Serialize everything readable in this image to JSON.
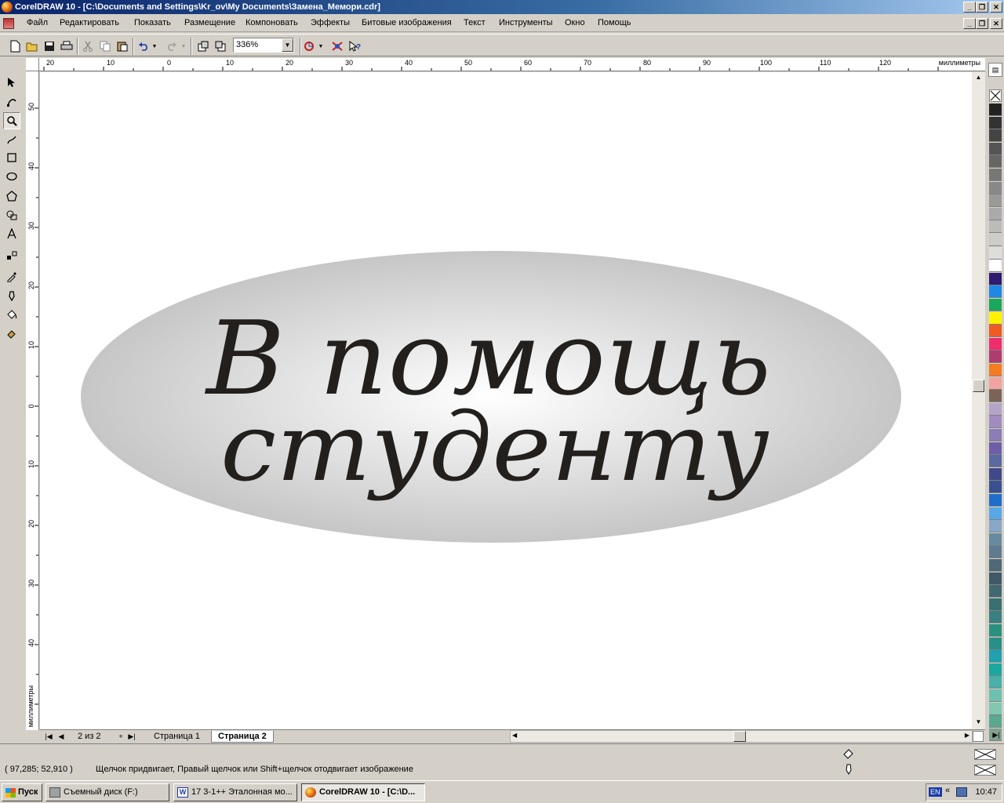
{
  "window": {
    "title": "CorelDRAW 10 - [C:\\Documents and Settings\\Kr_ov\\My Documents\\Замена_Мемори.cdr]"
  },
  "menu": [
    "Файл",
    "Редактировать",
    "Показать",
    "Размещение",
    "Компоновать",
    "Эффекты",
    "Битовые изображения",
    "Текст",
    "Инструменты",
    "Окно",
    "Помощь"
  ],
  "toolbar": {
    "zoom_value": "336%",
    "icons": [
      "new-icon",
      "open-icon",
      "save-icon",
      "print-icon",
      "cut-icon",
      "copy-icon",
      "paste-icon",
      "undo-icon",
      "redo-icon",
      "import-icon",
      "export-icon",
      "application-launcher-icon",
      "corel-online-icon",
      "whats-this-icon"
    ]
  },
  "rulers": {
    "horizontal_labels": [
      "20",
      "10",
      "0",
      "10",
      "20",
      "30",
      "40",
      "50",
      "60",
      "70",
      "80",
      "90",
      "100",
      "110",
      "120"
    ],
    "vertical_labels": [
      "50",
      "40",
      "30",
      "20",
      "10",
      "0",
      "10",
      "20",
      "30",
      "40"
    ],
    "unit": "миллиметры"
  },
  "canvas": {
    "line1": "В помощь",
    "line2": "студенту",
    "ellipse_gradient": [
      "#ffffff",
      "#c6c6c6"
    ],
    "text_color": "#231f1c"
  },
  "pages": {
    "counter": "2 из 2",
    "tabs": [
      "Страница 1",
      "Страница 2"
    ],
    "active": "Страница 2"
  },
  "status": {
    "coords": "( 97,285; 52,910 )",
    "hint": "Щелчок придвигает, Правый щелчок или Shift+щелчок отодвигает изображение"
  },
  "palette": [
    "#222222",
    "#333333",
    "#444444",
    "#555555",
    "#666666",
    "#777777",
    "#888888",
    "#999999",
    "#aaaaaa",
    "#bbbbbb",
    "#cccccc",
    "#dddddd",
    "#ffffff",
    "#2e1a6e",
    "#1e88e5",
    "#1aa85a",
    "#fff200",
    "#f05a23",
    "#ee2d6e",
    "#b03b6e",
    "#f47b20",
    "#f2a3a0",
    "#7a6458",
    "#b4a4c8",
    "#a08cc0",
    "#8c7cb8",
    "#6e5ea8",
    "#5a6aa0",
    "#404a88",
    "#3a5090",
    "#1f6ec8",
    "#58a8e8",
    "#88a8c8",
    "#688aa0",
    "#607a90",
    "#506878",
    "#405868",
    "#406a70",
    "#3a7070",
    "#3a8080",
    "#2a9080",
    "#289088",
    "#22a0b0",
    "#1aa8a0",
    "#4ab0a8",
    "#6ec0b0",
    "#80c8b0",
    "#5aa890",
    "#80a090"
  ],
  "taskbar": {
    "start": "Пуск",
    "tasks": [
      "Съемный диск (F:)",
      "17 3-1++ Эталонная мо...",
      "CorelDRAW 10 - [C:\\D..."
    ],
    "lang": "EN",
    "clock": "10:47"
  }
}
